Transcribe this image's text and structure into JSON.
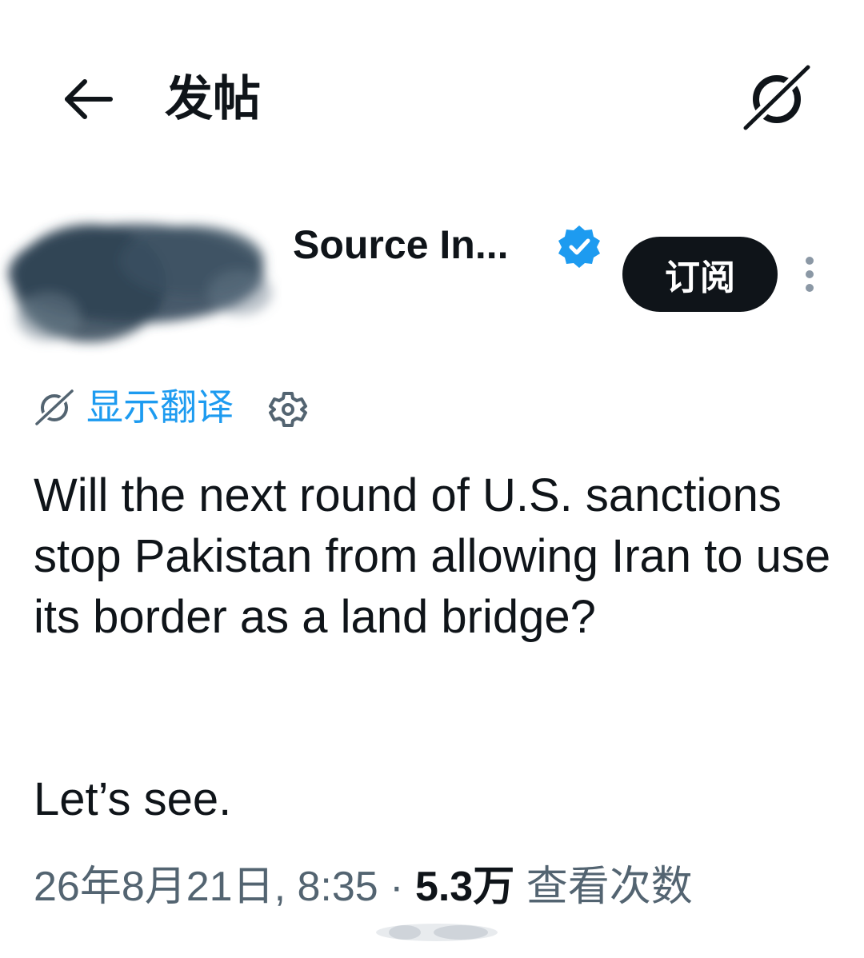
{
  "header": {
    "back_icon": "arrow-left-icon",
    "title": "发帖",
    "grok_icon": "grok-slash-icon"
  },
  "author": {
    "avatar": "blurred-avatar",
    "name": "Source In...",
    "verified_icon": "verified-badge-icon",
    "verified_color": "#1d9bf0",
    "subscribe_label": "订阅",
    "more_icon": "vertical-ellipsis-icon"
  },
  "translate": {
    "icon": "grok-slash-icon",
    "label": "显示翻译",
    "settings_icon": "gear-icon",
    "color": "#1d9bf0"
  },
  "post": {
    "text": "Will the next round of U.S. sanctions stop Pakistan from allowing Iran to use its border as a land bridge?",
    "text_tail": "Let’s see."
  },
  "meta": {
    "date": "26年8月21日, 8:35",
    "separator": "·",
    "views_count": "5.3万",
    "views_label": "查看次数"
  },
  "colors": {
    "text": "#0f1419",
    "muted": "#536471",
    "accent": "#1d9bf0"
  }
}
